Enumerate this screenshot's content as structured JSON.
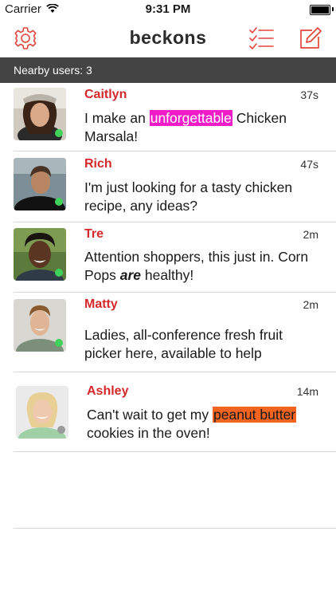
{
  "status_bar": {
    "carrier": "Carrier",
    "time": "9:31 PM"
  },
  "nav": {
    "title": "beckons",
    "accent": "#e2463a"
  },
  "section": {
    "header": "Nearby users: 3"
  },
  "users": [
    {
      "name": "Caitlyn",
      "age": "37s",
      "msg_before": "I make an ",
      "msg_highlight": "unforgettable",
      "msg_after": " Chicken Marsala!",
      "online": true
    },
    {
      "name": "Rich",
      "age": "47s",
      "msg": "I'm just looking for a tasty chicken recipe, any ideas?",
      "online": true
    },
    {
      "name": "Tre",
      "age": "2m",
      "msg_before": "Attention shoppers, this just in. Corn Pops ",
      "msg_emph": "are",
      "msg_after": " healthy!",
      "online": true
    },
    {
      "name": "Matty",
      "age": "2m",
      "msg": "Ladies, all-conference fresh fruit picker here, available to help",
      "online": true
    },
    {
      "name": "Ashley",
      "age": "14m",
      "msg_before": "Can't wait to get my ",
      "msg_highlight": "peanut butter",
      "msg_after": " cookies in the oven!",
      "online": false
    }
  ],
  "colors": {
    "online": "#3fd15a",
    "offline": "#9a9a9a",
    "name": "#d6282b",
    "highlight_pink": "#f01cc8",
    "highlight_orange": "#f26420"
  }
}
